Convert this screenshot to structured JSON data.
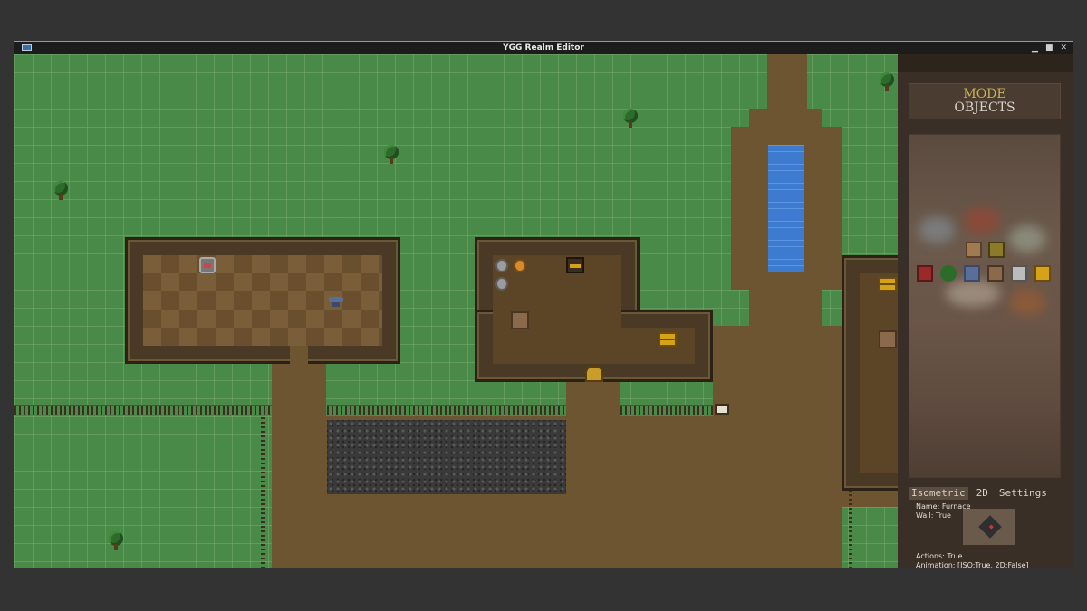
{
  "window": {
    "title": "YGG Realm Editor",
    "minimize": "▁",
    "maximize": "■",
    "close": "✕"
  },
  "panel": {
    "mode_label": "MODE",
    "mode_value": "OBJECTS",
    "tabs": [
      "Isometric",
      "2D",
      "Settings"
    ],
    "active_tab": "Isometric",
    "info": {
      "name": "Name: Furnace",
      "wall": "Wall: True",
      "actions": "Actions: True",
      "animation": "Animation: [ISO:True, 2D:False]"
    }
  },
  "colors": {
    "grass": "#4a8a48",
    "dirt": "#6e5532",
    "water": "#3d7bd0",
    "panel": "#3a2f26",
    "mode_label": "#c8b45a"
  }
}
